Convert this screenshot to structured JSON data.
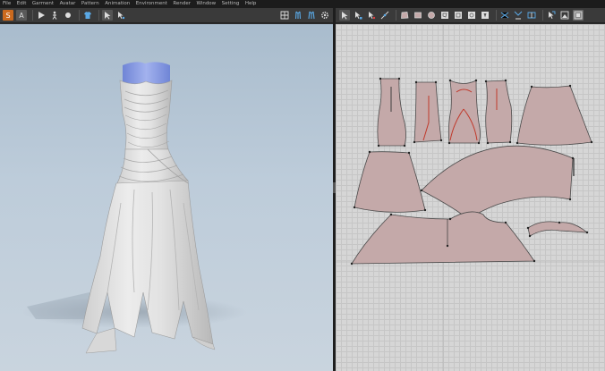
{
  "menu": [
    "File",
    "Edit",
    "Garment",
    "Avatar",
    "Pattern",
    "Animation",
    "Environment",
    "Render",
    "Window",
    "Setting",
    "Help"
  ],
  "toolbar_left": {
    "icons": [
      "simulation-icon",
      "avatar-icon",
      "play-icon",
      "walk-icon",
      "record-icon",
      "garment-icon",
      "select-icon",
      "transform-icon"
    ]
  },
  "toolbar_right": {
    "icons": [
      "select-pattern-icon",
      "transform-pattern-icon",
      "edit-point-icon",
      "add-point-icon",
      "polygon-icon",
      "rectangle-icon",
      "circle-icon",
      "internal-polygon-icon",
      "internal-rectangle-icon",
      "internal-circle-icon",
      "dart-icon",
      "segment-sewing-icon",
      "free-sewing-icon",
      "fold-icon",
      "arrangement-icon",
      "texture-icon"
    ]
  },
  "colors": {
    "pattern_fill": "#c4a9a9",
    "grid": "#d6d6d6",
    "viewport_bg": "#bdccda",
    "accent_toolbar": "#cc6a1e"
  }
}
